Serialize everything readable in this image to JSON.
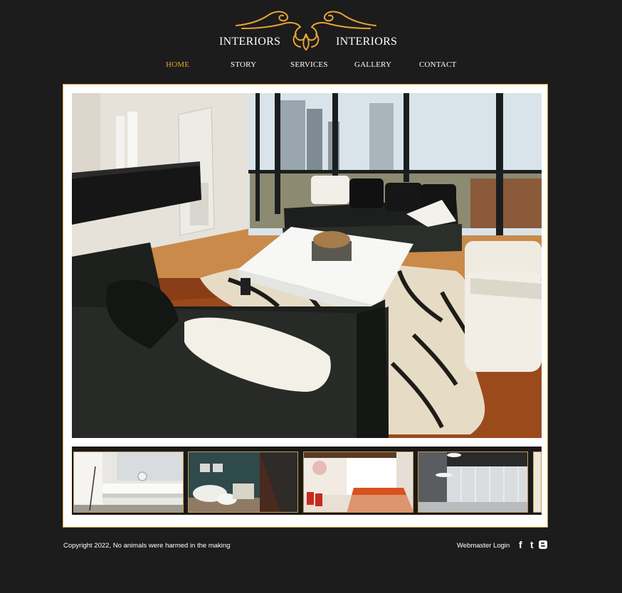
{
  "logo": {
    "left_word": "INTERIORS",
    "right_word": "INTERIORS",
    "ornament": "filigree-ornament-icon",
    "color": "#e8a534"
  },
  "nav": {
    "items": [
      {
        "label": "HOME",
        "active": true
      },
      {
        "label": "STORY",
        "active": false
      },
      {
        "label": "SERVICES",
        "active": false
      },
      {
        "label": "GALLERY",
        "active": false
      },
      {
        "label": "CONTACT",
        "active": false
      }
    ],
    "active_color": "#e8a534"
  },
  "gallery": {
    "frame_border_color": "#e0a13a",
    "thumbnails": [
      "white-kitchen-thumb",
      "teal-wall-living-room-thumb",
      "orange-dining-room-thumb",
      "glass-office-corridor-thumb"
    ]
  },
  "footer": {
    "copyright": "Copyright 2022, No animals were harmed in the making",
    "webmaster_login": "Webmaster Login",
    "social": [
      {
        "name": "facebook-icon",
        "glyph": "f"
      },
      {
        "name": "twitter-icon",
        "glyph": "t"
      },
      {
        "name": "blogger-icon",
        "glyph": "B"
      }
    ]
  }
}
